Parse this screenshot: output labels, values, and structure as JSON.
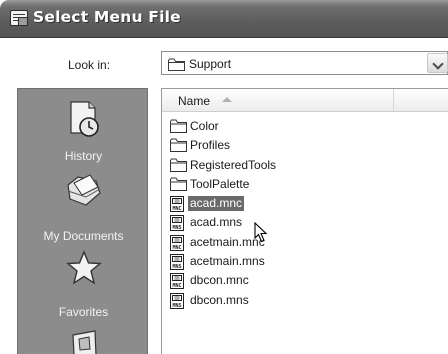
{
  "window": {
    "title": "Select Menu File",
    "title_icon": "dialog-icon"
  },
  "look_in": {
    "label": "Look in:",
    "value": "Support",
    "dropdown_icon": "chevron-down-icon"
  },
  "places": [
    {
      "label": "History",
      "icon": "history-clock-icon"
    },
    {
      "label": "My Documents",
      "icon": "documents-folder-icon"
    },
    {
      "label": "Favorites",
      "icon": "favorites-star-icon"
    },
    {
      "label": "",
      "icon": "desktop-icon"
    }
  ],
  "file_list": {
    "column_header": "Name",
    "sort_icon": "sort-ascending-icon",
    "items": [
      {
        "name": "Color",
        "type": "folder",
        "selected": false
      },
      {
        "name": "Profiles",
        "type": "folder",
        "selected": false
      },
      {
        "name": "RegisteredTools",
        "type": "folder",
        "selected": false
      },
      {
        "name": "ToolPalette",
        "type": "folder",
        "selected": false
      },
      {
        "name": "acad.mnc",
        "type": "mnc",
        "selected": true
      },
      {
        "name": "acad.mns",
        "type": "mns",
        "selected": false
      },
      {
        "name": "acetmain.mnc",
        "type": "mnc",
        "selected": false
      },
      {
        "name": "acetmain.mns",
        "type": "mns",
        "selected": false
      },
      {
        "name": "dbcon.mnc",
        "type": "mnc",
        "selected": false
      },
      {
        "name": "dbcon.mns",
        "type": "mns",
        "selected": false
      }
    ]
  },
  "colors": {
    "title_bar": "#5e5e5e",
    "places_bar": "#8c8c8c",
    "selection": "#6a6a6a"
  }
}
